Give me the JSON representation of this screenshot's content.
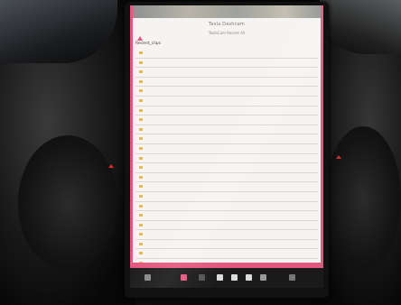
{
  "screen": {
    "title": "Tesla Dashcam",
    "subtitle": "TeslaCam   Recent   All",
    "folder": "Recent_clips",
    "footer": "",
    "accent_color": "#e4577d"
  },
  "files": [
    {
      "name": "Recent_clips",
      "meta": "",
      "chev": ""
    },
    {
      "name": "",
      "meta": "",
      "chev": ""
    },
    {
      "name": "",
      "meta": "",
      "chev": ""
    },
    {
      "name": "",
      "meta": "",
      "chev": ""
    },
    {
      "name": "",
      "meta": "",
      "chev": ""
    },
    {
      "name": "",
      "meta": "",
      "chev": ""
    },
    {
      "name": "",
      "meta": "",
      "chev": ""
    },
    {
      "name": "",
      "meta": "",
      "chev": ""
    },
    {
      "name": "",
      "meta": "",
      "chev": ""
    },
    {
      "name": "",
      "meta": "",
      "chev": ""
    },
    {
      "name": "",
      "meta": "",
      "chev": ""
    },
    {
      "name": "",
      "meta": "",
      "chev": ""
    },
    {
      "name": "",
      "meta": "",
      "chev": ""
    },
    {
      "name": "",
      "meta": "",
      "chev": ""
    },
    {
      "name": "",
      "meta": "",
      "chev": ""
    },
    {
      "name": "",
      "meta": "",
      "chev": ""
    },
    {
      "name": "",
      "meta": "",
      "chev": ""
    },
    {
      "name": "",
      "meta": "",
      "chev": ""
    },
    {
      "name": "",
      "meta": "",
      "chev": ""
    },
    {
      "name": "",
      "meta": "",
      "chev": ""
    },
    {
      "name": "",
      "meta": "",
      "chev": ""
    },
    {
      "name": "",
      "meta": "",
      "chev": ""
    },
    {
      "name": "",
      "meta": "",
      "chev": ""
    },
    {
      "name": "",
      "meta": "",
      "chev": ""
    },
    {
      "name": "",
      "meta": "",
      "chev": ""
    }
  ],
  "icons": [
    "alert-icon",
    "folder-icon",
    "chevron-right-icon",
    "hazard-icon"
  ]
}
